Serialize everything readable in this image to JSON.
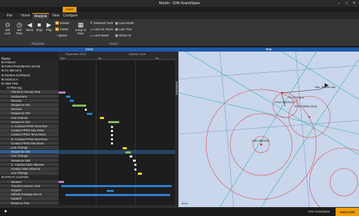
{
  "window": {
    "title": "Marlin - ION GrandSpan"
  },
  "contextual_tab": {
    "label": "Gantt"
  },
  "tabs": [
    "File",
    "Home",
    "Analysis",
    "View",
    "Configure"
  ],
  "ribbon": {
    "set_live": "Set Live",
    "set_time": "Set Time",
    "back": "Back",
    "stop": "Stop",
    "play": "Play",
    "slower": "Slower",
    "faster": "Faster",
    "speed": "Speed",
    "jump_to_now": "Jump to Now",
    "selected_task": "Selected Task",
    "last_24_hours": "Last 24 Hours",
    "last_week": "Last Week",
    "last_month": "Last Month",
    "last_year": "Last Year",
    "show_all": "Show All",
    "group_playback": "Playback",
    "group_zoom": "Zoom"
  },
  "gantt": {
    "pane_title": "Gantt",
    "name_header": "Name",
    "months": [
      "September 2018",
      "October 2018"
    ],
    "days": [
      "25th",
      "1st",
      "7th"
    ],
    "rows": [
      {
        "label": "FADILIA",
        "kind": "top"
      },
      {
        "label": "FURUTOSHIMARU NO.58",
        "kind": "top"
      },
      {
        "label": "HV MR-23-S",
        "kind": "top"
      },
      {
        "label": "GENOA EXPRESS",
        "kind": "top"
      },
      {
        "label": "SIGELE A",
        "kind": "top"
      },
      {
        "label": "HMS TM3",
        "kind": "top"
      },
      {
        "label": "Planning",
        "kind": "group"
      },
      {
        "label": "Transit to Survey Area",
        "kind": "sub"
      },
      {
        "label": "Deployment",
        "kind": "sub"
      },
      {
        "label": "Recircle",
        "kind": "sub"
      },
      {
        "label": "Sequence 032",
        "kind": "sub"
      },
      {
        "label": "Recircle",
        "kind": "sub"
      },
      {
        "label": "Sequence 033",
        "kind": "sub"
      },
      {
        "label": "Line Change",
        "kind": "sub"
      },
      {
        "label": "Sequence 034",
        "kind": "sub"
      },
      {
        "label": "A. Contact FPSO Terra Nov",
        "kind": "sub"
      },
      {
        "label": "Contact FPSO Sea Rose",
        "kind": "sub"
      },
      {
        "label": "Contact FPSO Terra Nova",
        "kind": "sub"
      },
      {
        "label": "B. Contact FPSO Sea Rose",
        "kind": "sub"
      },
      {
        "label": "Contact FPSO Sea Rose",
        "kind": "sub"
      },
      {
        "label": "Line Change",
        "kind": "sub"
      },
      {
        "label": "Sequence 035",
        "kind": "sel"
      },
      {
        "label": "Line Change",
        "kind": "sub"
      },
      {
        "label": "Sequence 036",
        "kind": "sub"
      },
      {
        "label": "C. Contact GBS Hibernia",
        "kind": "sub"
      },
      {
        "label": "Contact GBS Hibernia",
        "kind": "sub"
      },
      {
        "label": "Line Change",
        "kind": "sub"
      },
      {
        "label": "STRAIT HUNTER",
        "kind": "top"
      },
      {
        "label": "Support",
        "kind": "sub"
      },
      {
        "label": "Transit to Survey Area",
        "kind": "sub"
      },
      {
        "label": "Support",
        "kind": "sub"
      },
      {
        "label": "Oilfield Passage Escort",
        "kind": "sub"
      },
      {
        "label": "Support",
        "kind": "sub"
      },
      {
        "label": "Return to Port",
        "kind": "sub"
      }
    ]
  },
  "map": {
    "pane_title": "Map",
    "labels": [
      "Ship - Pipeline 16A",
      "FPSO SEA ROSE",
      "FPSO TERRA NOVA",
      "PLATFORM 3",
      "GBS HIBERNIA"
    ],
    "scale_text": "40 km"
  },
  "status": {
    "user": "ION GrandSpan",
    "mode": "ANALYSIS"
  },
  "colors": {
    "accent": "#f5a000",
    "pane_header": "#1e5aa8"
  }
}
